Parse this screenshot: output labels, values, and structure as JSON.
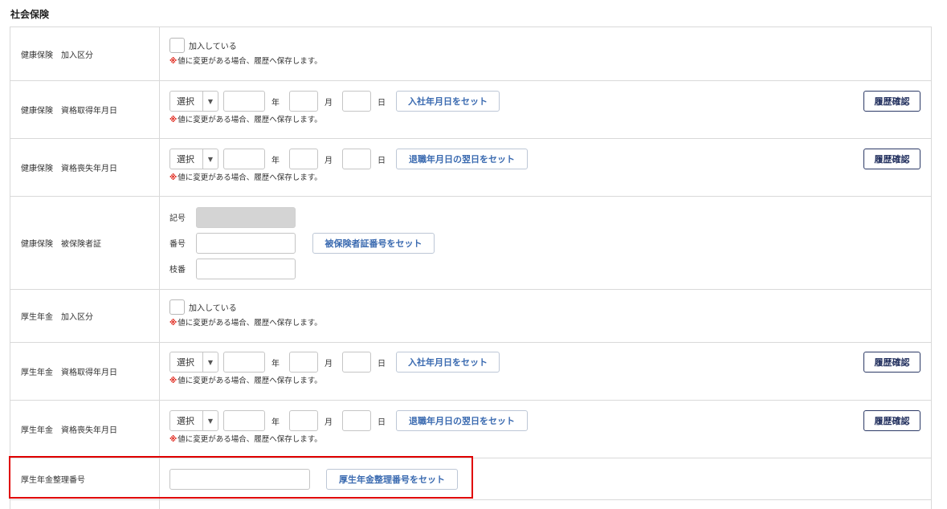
{
  "section_title": "社会保険",
  "labels": {
    "enroll_checkbox": "加入している",
    "note_mark": "※",
    "note_text": "値に変更がある場合、履歴へ保存します。",
    "select_default": "選択",
    "year_unit": "年",
    "month_unit": "月",
    "day_unit": "日",
    "history_button": "履歴確認",
    "set_join_date": "入社年月日をセット",
    "set_retire_next": "退職年月日の翌日をセット",
    "kigou": "記号",
    "bangou": "番号",
    "edaban": "枝番",
    "set_insured_number": "被保険者証番号をセット",
    "set_pension_number": "厚生年金整理番号をセット"
  },
  "rows": {
    "hi_enroll": "健康保険　加入区分",
    "hi_acquire": "健康保険　資格取得年月日",
    "hi_lose": "健康保険　資格喪失年月日",
    "hi_card": "健康保険　被保険者証",
    "pe_enroll": "厚生年金　加入区分",
    "pe_acquire": "厚生年金　資格取得年月日",
    "pe_lose": "厚生年金　資格喪失年月日",
    "pe_number": "厚生年金整理番号"
  },
  "colors": {
    "highlight": "#e00000",
    "note_mark": "#e0261b",
    "set_button_text": "#3a6ab0",
    "history_button_border": "#2c3a66"
  },
  "icons": {
    "select_arrow": "caret-down-icon"
  }
}
